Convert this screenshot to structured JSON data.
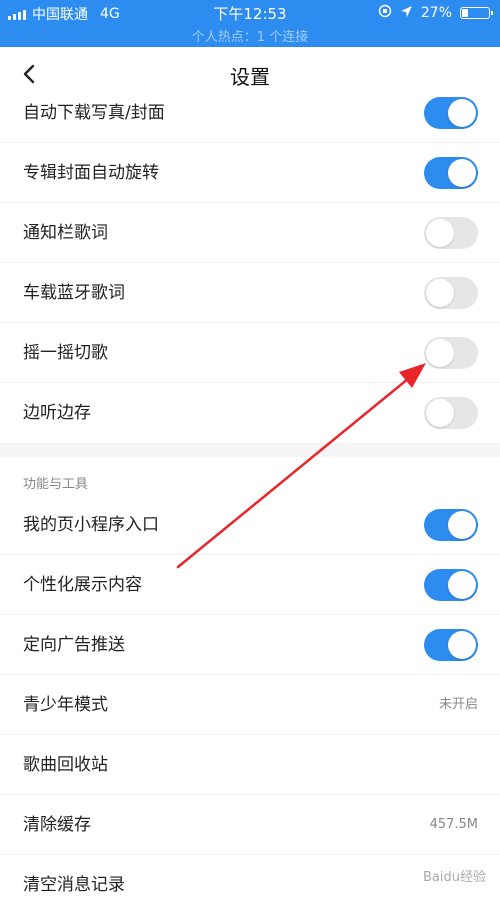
{
  "status": {
    "carrier": "中国联通",
    "network": "4G",
    "time": "下午12:53",
    "battery": "27%",
    "battery_level": 0.27,
    "hotspot": "个人热点：1 个连接"
  },
  "nav": {
    "title": "设置"
  },
  "settings": [
    {
      "label": "自动下载写真/封面",
      "type": "toggle",
      "on": true
    },
    {
      "label": "专辑封面自动旋转",
      "type": "toggle",
      "on": true
    },
    {
      "label": "通知栏歌词",
      "type": "toggle",
      "on": false
    },
    {
      "label": "车载蓝牙歌词",
      "type": "toggle",
      "on": false
    },
    {
      "label": "摇一摇切歌",
      "type": "toggle",
      "on": false
    },
    {
      "label": "边听边存",
      "type": "toggle",
      "on": false
    }
  ],
  "tools_section": {
    "title": "功能与工具",
    "items": [
      {
        "label": "我的页小程序入口",
        "type": "toggle",
        "on": true
      },
      {
        "label": "个性化展示内容",
        "type": "toggle",
        "on": true
      },
      {
        "label": "定向广告推送",
        "type": "toggle",
        "on": true
      },
      {
        "label": "青少年模式",
        "type": "value",
        "value": "未开启"
      },
      {
        "label": "歌曲回收站",
        "type": "none"
      },
      {
        "label": "清除缓存",
        "type": "value",
        "value": "457.5M"
      },
      {
        "label": "清空消息记录",
        "type": "none"
      }
    ]
  },
  "watermark": "Baidu经验",
  "colors": {
    "accent": "#2d8cf0",
    "toggle_off": "#e6e6e6",
    "arrow": "#e8262a"
  }
}
